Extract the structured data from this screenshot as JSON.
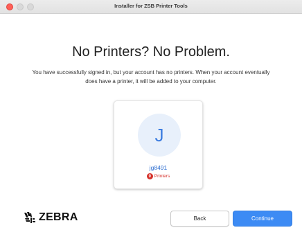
{
  "window": {
    "title": "Installer for ZSB Printer Tools"
  },
  "main": {
    "heading": "No Printers? No Problem.",
    "subtitle": "You have successfully signed in, but your account has no printers. When your account eventually does have a printer, it will be added to your computer."
  },
  "account": {
    "initial": "J",
    "username": "jg8491",
    "printer_count": "0",
    "printers_label": "Printers"
  },
  "brand": {
    "logo_text": "ZEBRA"
  },
  "footer": {
    "back_label": "Back",
    "continue_label": "Continue"
  },
  "colors": {
    "accent": "#3d8bf4",
    "avatar_bg": "#e8f0fb",
    "badge": "#d6322b"
  }
}
